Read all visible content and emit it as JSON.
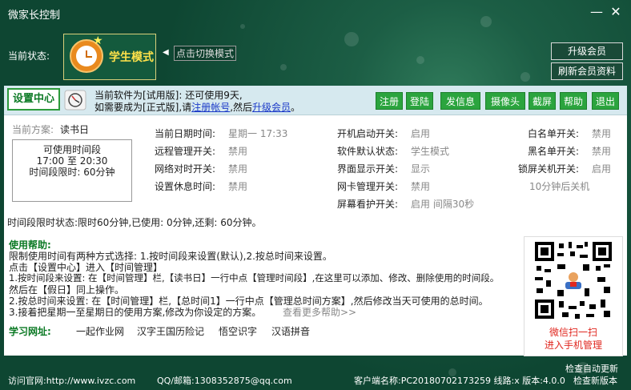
{
  "window": {
    "title": "微家长控制",
    "minimize": "—",
    "close": "✕"
  },
  "status": {
    "label": "当前状态:",
    "mode": "学生模式",
    "switch_arrow": "◀",
    "switch_link": "点击切换模式"
  },
  "vip": {
    "upgrade": "升级会员",
    "refresh": "刷新会员资料"
  },
  "topbar": {
    "set_center": "设置中心",
    "line1": "当前软件为[试用版]: 还可使用9天,",
    "line2_a": "如需要成为[正式版],请",
    "register_link": "注册帐号",
    "line2_b": ",然后",
    "upgrade_link": "升级会员",
    "line2_c": "。",
    "buttons": [
      "注册",
      "登陆",
      "发信息",
      "摄像头",
      "截屏",
      "帮助",
      "退出"
    ]
  },
  "plan": {
    "label": "当前方案:",
    "value": "读书日",
    "box_title": "可使用时间段",
    "time_range": "17:00 至 20:30",
    "limit": "时间段限时: 60分钟"
  },
  "settings": {
    "col1": [
      {
        "label": "当前日期时间:",
        "value": "星期一 17:33"
      },
      {
        "label": "远程管理开关:",
        "value": "禁用"
      },
      {
        "label": "网络对时开关:",
        "value": "禁用"
      },
      {
        "label": "设置休息时间:",
        "value": "禁用"
      }
    ],
    "col2": [
      {
        "label": "开机启动开关:",
        "value": "启用"
      },
      {
        "label": "软件默认状态:",
        "value": "学生模式"
      },
      {
        "label": "界面显示开关:",
        "value": "显示"
      },
      {
        "label": "网卡管理开关:",
        "value": "禁用"
      },
      {
        "label": "屏幕看护开关:",
        "value": "启用 间隔30秒"
      }
    ],
    "col3": [
      {
        "label": "白名单开关:",
        "value": "禁用"
      },
      {
        "label": "黑名单开关:",
        "value": "禁用"
      },
      {
        "label": "锁屏关机开关:",
        "value": "启用"
      }
    ],
    "shutdown_note": "10分钟后关机"
  },
  "time_status": "时间段限时状态:限时60分钟,已使用: 0分钟,还剩: 60分钟。",
  "help": {
    "title": "使用帮助:",
    "lines": [
      "限制使用时间有两种方式选择: 1.按时间段来设置(默认),2.按总时间来设置。",
      "点击【设置中心】进入【时间管理】",
      "1.按时间段来设置: 在【时间管理】栏,【读书日】一行中点【管理时间段】,在这里可以添加、修改、删除使用的时间段。",
      "然后在【假日】同上操作。",
      "2.按总时间来设置: 在【时间管理】栏,【总时间1】一行中点【管理总时间方案】,然后修改当天可使用的总时间。",
      "3.接着把星期一至星期日的使用方案,修改为你设定的方案。"
    ],
    "more": "查看更多帮助>>"
  },
  "learning": {
    "label": "学习网址:",
    "links": [
      "一起作业网",
      "汉字王国历险记",
      "悟空识字",
      "汉语拼音"
    ]
  },
  "qr": {
    "line1": "微信扫一扫",
    "line2": "进入手机管理"
  },
  "footer": {
    "site": "访问官网:http://www.ivzc.com",
    "contact": "QQ/邮箱:1308352875@qq.com",
    "client": "客户端名称:PC20180702173259 线路:x 版本:4.0.0",
    "check_auto": "检查自动更新",
    "check_new": "检查新版本"
  },
  "colors": {
    "accent_green": "#2ba43e",
    "link_blue": "#1a39c8",
    "qr_caption": "#e0271f"
  }
}
